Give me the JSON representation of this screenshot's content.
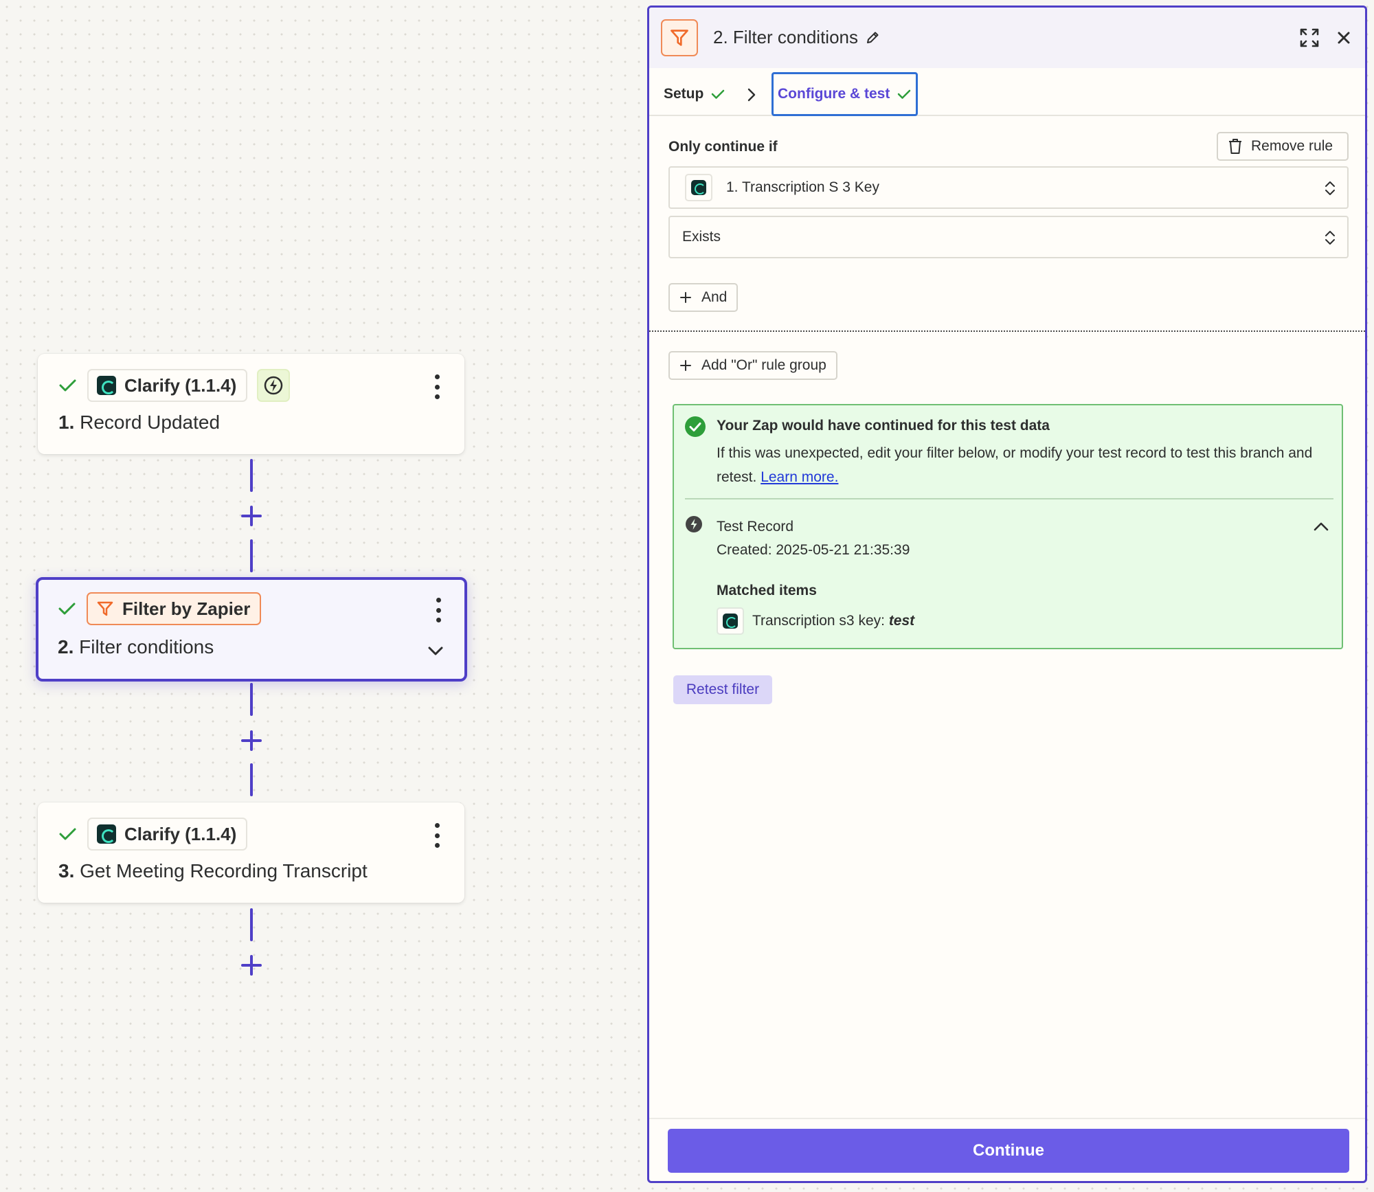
{
  "canvas": {
    "steps": [
      {
        "app_label": "Clarify (1.1.4)",
        "number": "1.",
        "title": "Record Updated",
        "icon": "clarify-logo-icon",
        "has_trigger_badge": true
      },
      {
        "app_label": "Filter by Zapier",
        "number": "2.",
        "title": "Filter conditions",
        "icon": "filter-icon",
        "selected": true
      },
      {
        "app_label": "Clarify (1.1.4)",
        "number": "3.",
        "title": "Get Meeting Recording Transcript",
        "icon": "clarify-logo-icon"
      }
    ]
  },
  "panel": {
    "title": "2. Filter conditions",
    "tabs": [
      {
        "label": "Setup"
      },
      {
        "label": "Configure & test"
      }
    ],
    "rule": {
      "label": "Only continue if",
      "remove_label": "Remove rule",
      "field_value": "1. Transcription S 3 Key",
      "condition_value": "Exists",
      "and_label": "And",
      "or_label": "Add \"Or\" rule group"
    },
    "result": {
      "title": "Your Zap would have continued for this test data",
      "message": "If this was unexpected, edit your filter below, or modify your test record to test this branch and retest.",
      "link": "Learn more.",
      "record_title": "Test Record",
      "created": "Created: 2025-05-21 21:35:39",
      "matched_label": "Matched items",
      "matched_key": "Transcription s3 key:",
      "matched_value": "test"
    },
    "retest_label": "Retest filter",
    "continue_label": "Continue"
  },
  "colors": {
    "accent": "#4f3fc7",
    "button": "#6b5ce7",
    "success": "#2e9e3a",
    "filter_orange": "#f06a2a"
  }
}
